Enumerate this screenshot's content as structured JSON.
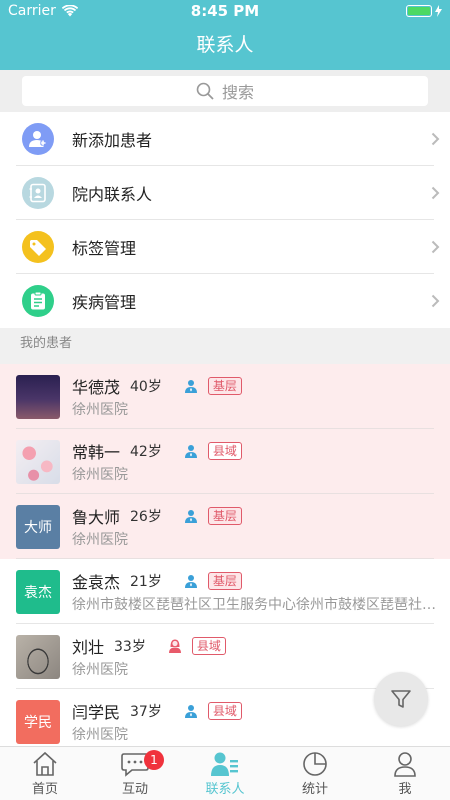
{
  "status_bar": {
    "carrier": "Carrier",
    "time": "8:45 PM"
  },
  "header": {
    "title": "联系人"
  },
  "search": {
    "placeholder": "搜索"
  },
  "menu": [
    {
      "label": "新添加患者",
      "icon": "add-patient-icon",
      "color": "#7f9cf5"
    },
    {
      "label": "院内联系人",
      "icon": "contact-card-icon",
      "color": "#b8d8e0"
    },
    {
      "label": "标签管理",
      "icon": "tag-icon",
      "color": "#f4c11e"
    },
    {
      "label": "疾病管理",
      "icon": "clipboard-icon",
      "color": "#2fcf8a"
    }
  ],
  "section_label": "我的患者",
  "patients": [
    {
      "name": "华德茂",
      "age": "40岁",
      "tag": "基层",
      "hospital": "徐州医院",
      "avatar_text": "",
      "gender": "male"
    },
    {
      "name": "常韩一",
      "age": "42岁",
      "tag": "县域",
      "hospital": "徐州医院",
      "avatar_text": "",
      "gender": "male"
    },
    {
      "name": "鲁大师",
      "age": "26岁",
      "tag": "基层",
      "hospital": "徐州医院",
      "avatar_text": "大师",
      "gender": "male"
    },
    {
      "name": "金袁杰",
      "age": "21岁",
      "tag": "基层",
      "hospital": "徐州市鼓楼区琵琶社区卫生服务中心徐州市鼓楼区琵琶社区卫生服务中心",
      "avatar_text": "袁杰",
      "gender": "male"
    },
    {
      "name": "刘壮",
      "age": "33岁",
      "tag": "县域",
      "hospital": "徐州医院",
      "avatar_text": "",
      "gender": "female"
    },
    {
      "name": "闫学民",
      "age": "37岁",
      "tag": "县域",
      "hospital": "徐州医院",
      "avatar_text": "学民",
      "gender": "male"
    }
  ],
  "tabbar": {
    "items": [
      {
        "label": "首页",
        "icon": "home-icon"
      },
      {
        "label": "互动",
        "icon": "chat-icon",
        "badge": "1"
      },
      {
        "label": "联系人",
        "icon": "contacts-icon",
        "active": true
      },
      {
        "label": "统计",
        "icon": "pie-chart-icon"
      },
      {
        "label": "我",
        "icon": "person-icon"
      }
    ]
  },
  "colors": {
    "accent": "#56c5d0",
    "tag_red": "#e05a6a",
    "badge_red": "#f0323c"
  }
}
